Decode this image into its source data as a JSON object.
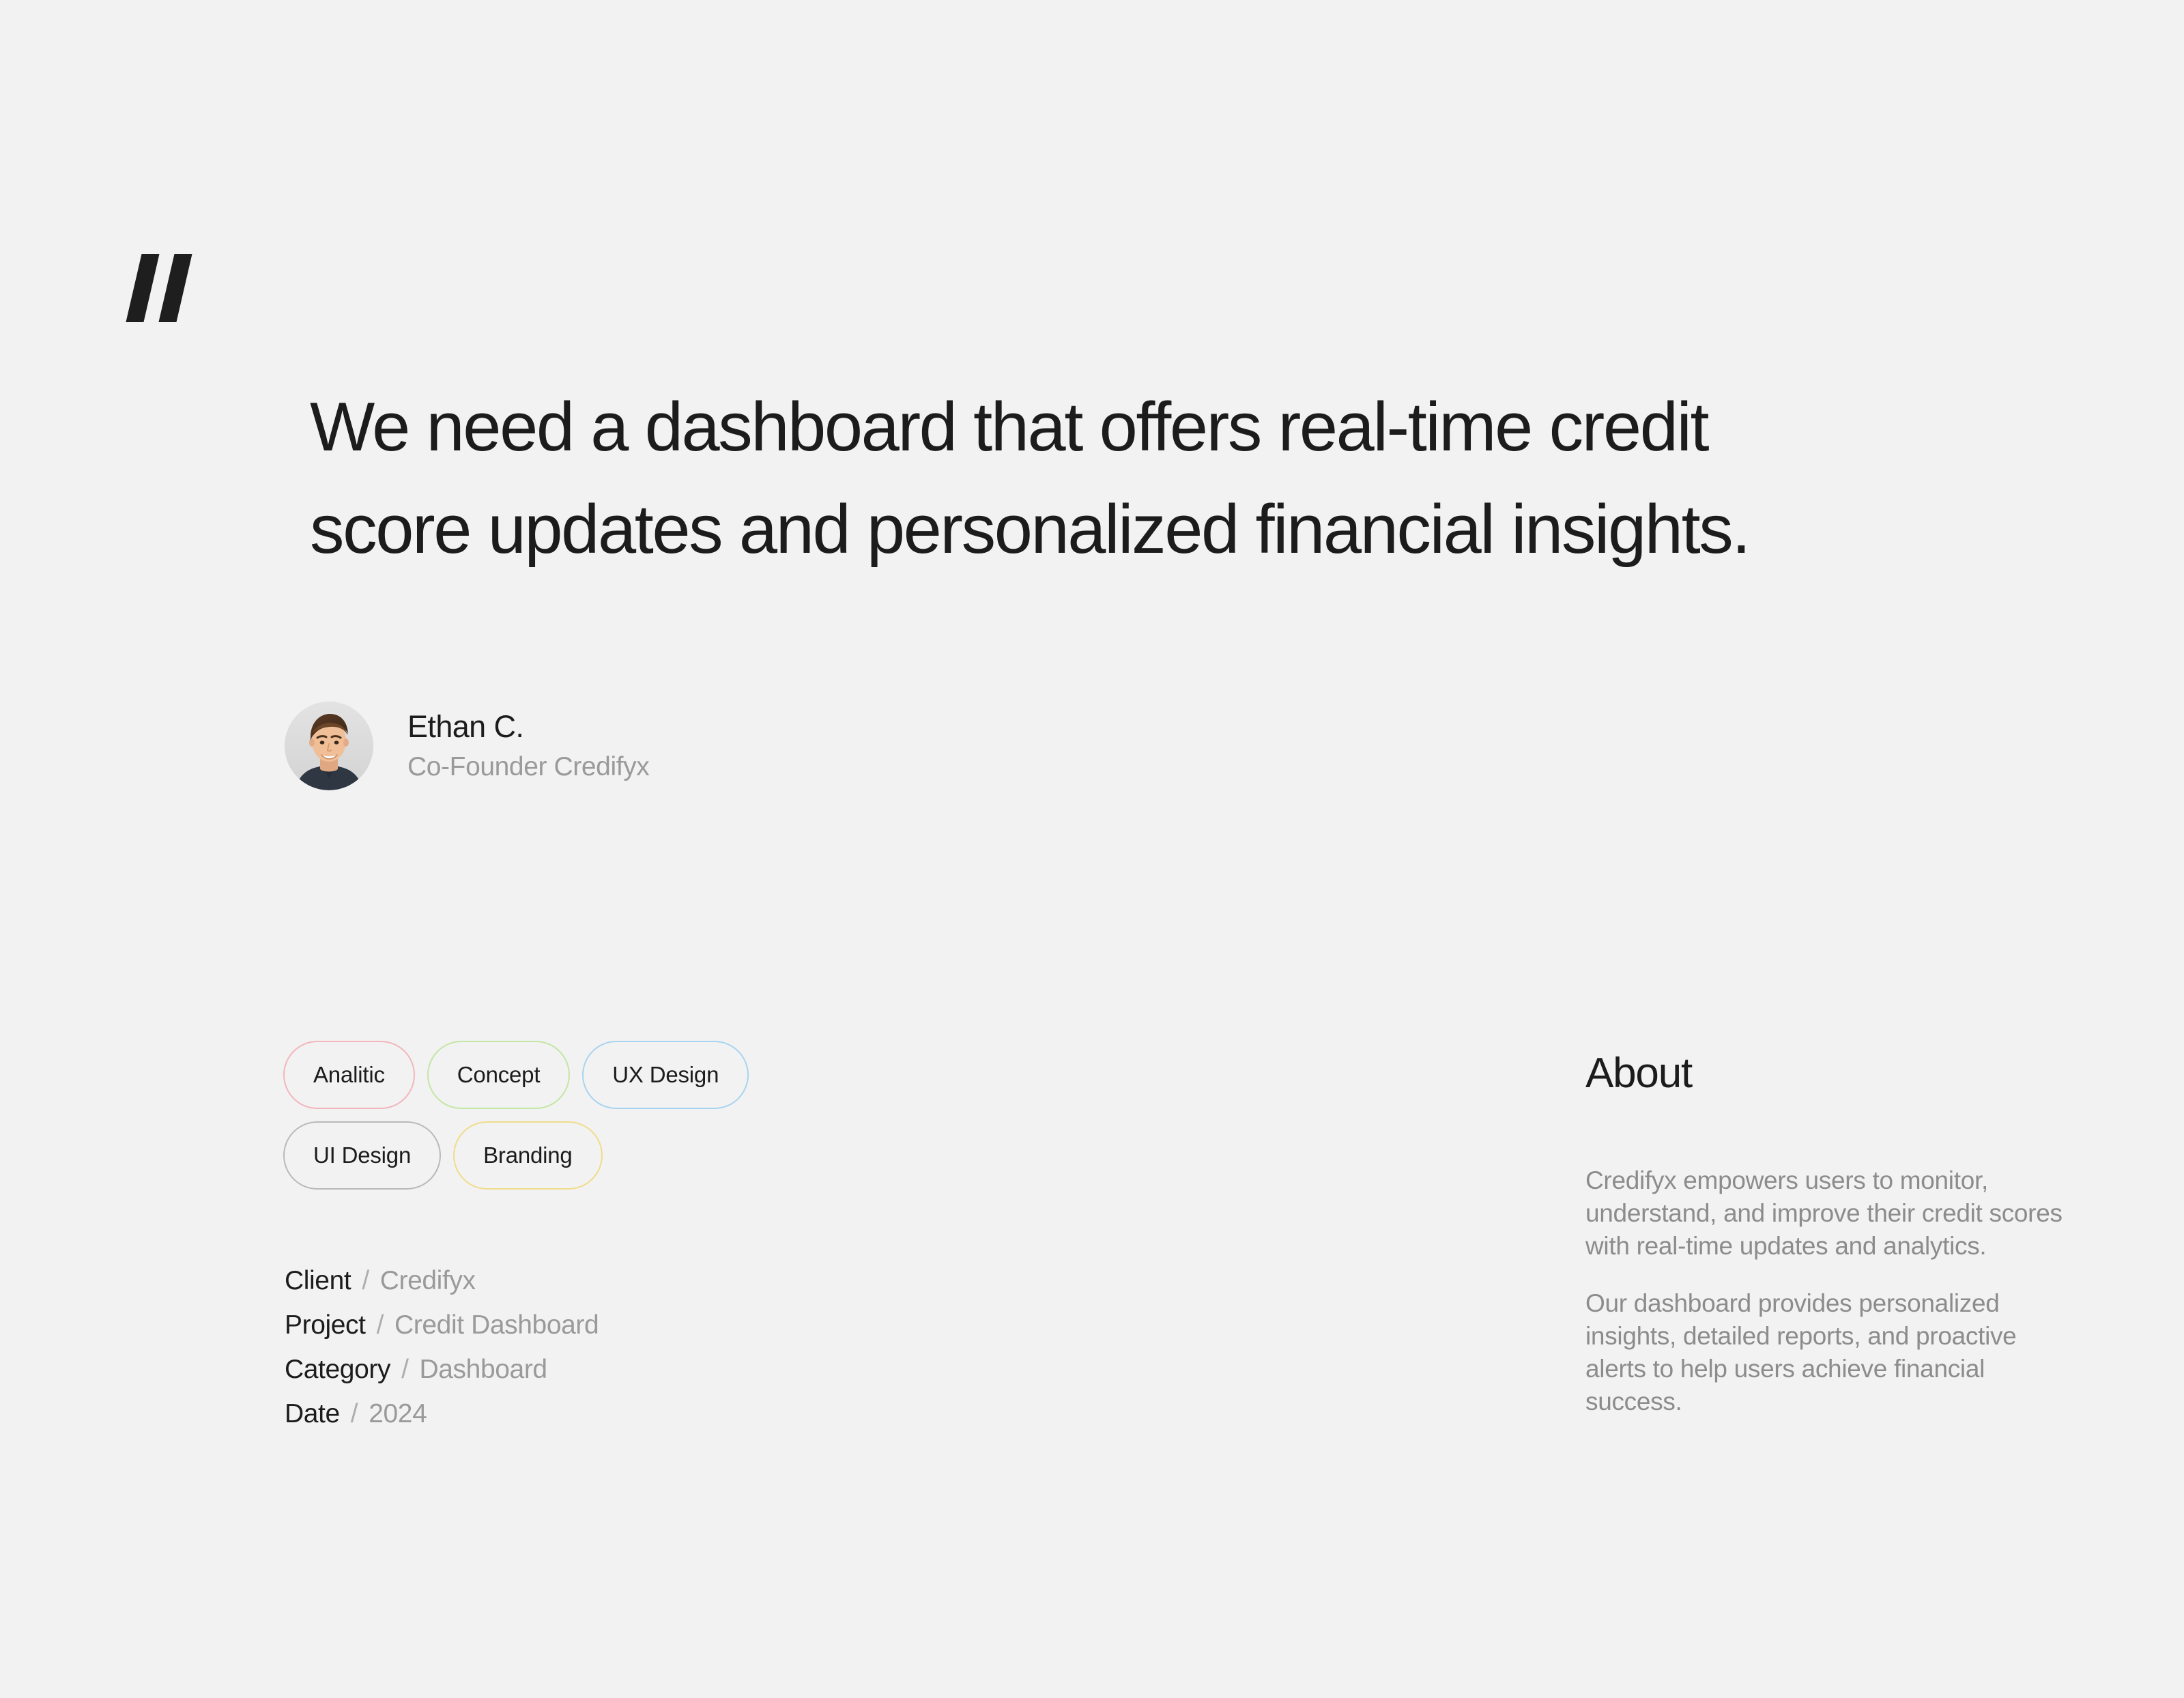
{
  "theme": {
    "background": "#f2f2f2",
    "text_primary": "#1c1c1c",
    "text_muted": "#9a9a9a"
  },
  "quote": {
    "mark": "\"",
    "text": "We need a dashboard that offers real-time credit score updates and personalized financial insights.",
    "author": {
      "name": "Ethan C.",
      "role": "Co-Founder Credifyx"
    }
  },
  "tags": [
    {
      "label": "Analitic",
      "border_color": "#f2b6bc"
    },
    {
      "label": "Concept",
      "border_color": "#c3e6a4"
    },
    {
      "label": "UX Design",
      "border_color": "#a8d4ef"
    },
    {
      "label": "UI Design",
      "border_color": "#b9b9b9"
    },
    {
      "label": "Branding",
      "border_color": "#f0dc8a"
    }
  ],
  "meta": {
    "separator": "/",
    "rows": [
      {
        "label": "Client",
        "value": "Credifyx"
      },
      {
        "label": "Project",
        "value": "Credit Dashboard"
      },
      {
        "label": "Category",
        "value": "Dashboard"
      },
      {
        "label": "Date",
        "value": "2024"
      }
    ]
  },
  "about": {
    "title": "About",
    "paragraphs": [
      "Credifyx empowers users to monitor, understand, and improve their credit scores with real-time updates and analytics.",
      "Our dashboard provides personalized insights, detailed reports, and proactive alerts to help users achieve financial success."
    ]
  }
}
